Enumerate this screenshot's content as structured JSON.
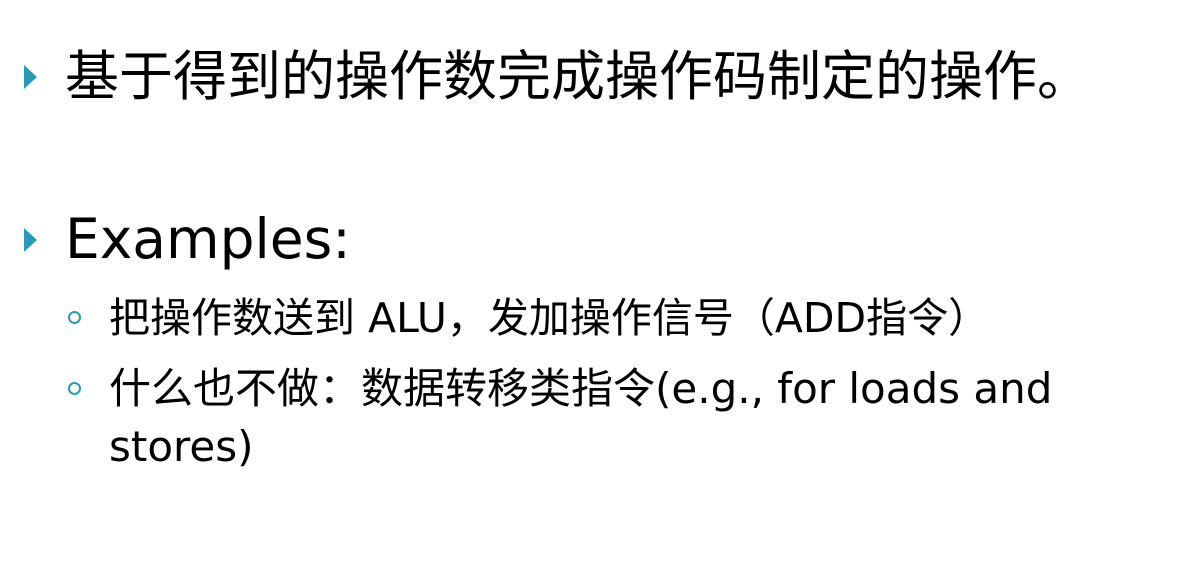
{
  "slide": {
    "bullets": [
      {
        "text": "基于得到的操作数完成操作码制定的操作。"
      },
      {
        "text": "Examples:"
      }
    ],
    "sub_bullets": [
      {
        "text": "把操作数送到 ALU，发加操作信号（ADD指令）"
      },
      {
        "text": "什么也不做：数据转移类指令(e.g., for loads and stores)"
      }
    ],
    "colors": {
      "bullet_accent": "#2c9ab7",
      "text": "#000000",
      "background": "#ffffff"
    },
    "icons": {
      "level1_bullet": "triangle-right-icon",
      "level2_bullet": "ring-bullet-icon"
    }
  }
}
